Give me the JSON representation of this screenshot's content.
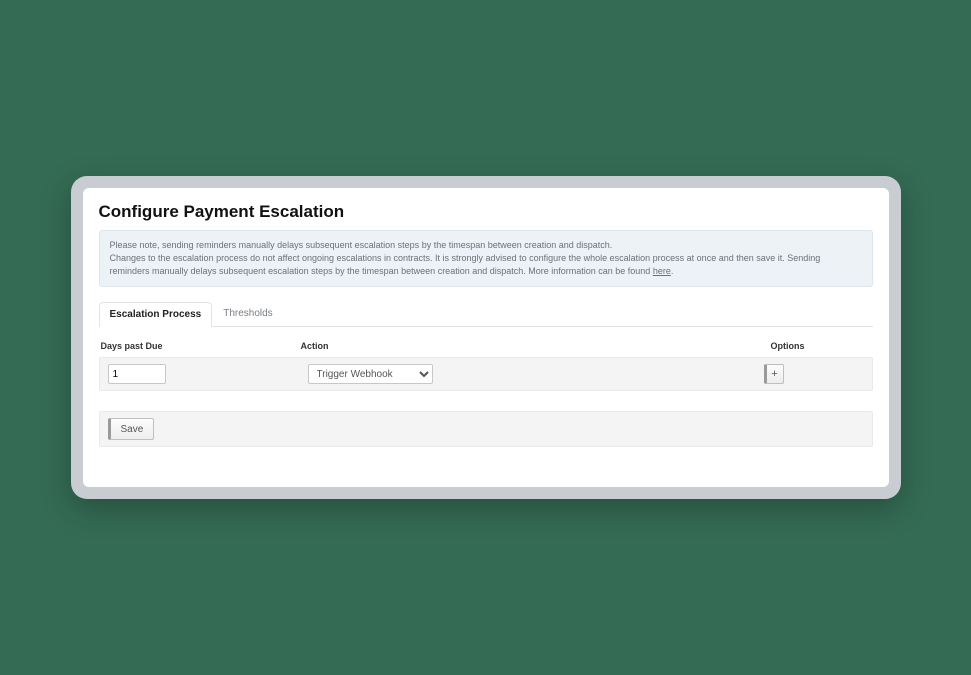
{
  "page": {
    "title": "Configure Payment Escalation"
  },
  "info": {
    "line1": "Please note, sending reminders manually delays subsequent escalation steps by the timespan between creation and dispatch.",
    "line2a": "Changes to the escalation process do not affect ongoing escalations in contracts. It is strongly advised to configure the whole escalation process at once and then save it. Sending reminders manually delays subsequent escalation steps by the timespan between creation and dispatch. More information can be found ",
    "link_label": "here",
    "line2b": "."
  },
  "tabs": {
    "escalation": "Escalation Process",
    "thresholds": "Thresholds"
  },
  "columns": {
    "days": "Days past Due",
    "action": "Action",
    "options": "Options"
  },
  "row": {
    "days_value": "1",
    "action_value": "Trigger Webhook",
    "add_label": "+"
  },
  "buttons": {
    "save": "Save"
  }
}
